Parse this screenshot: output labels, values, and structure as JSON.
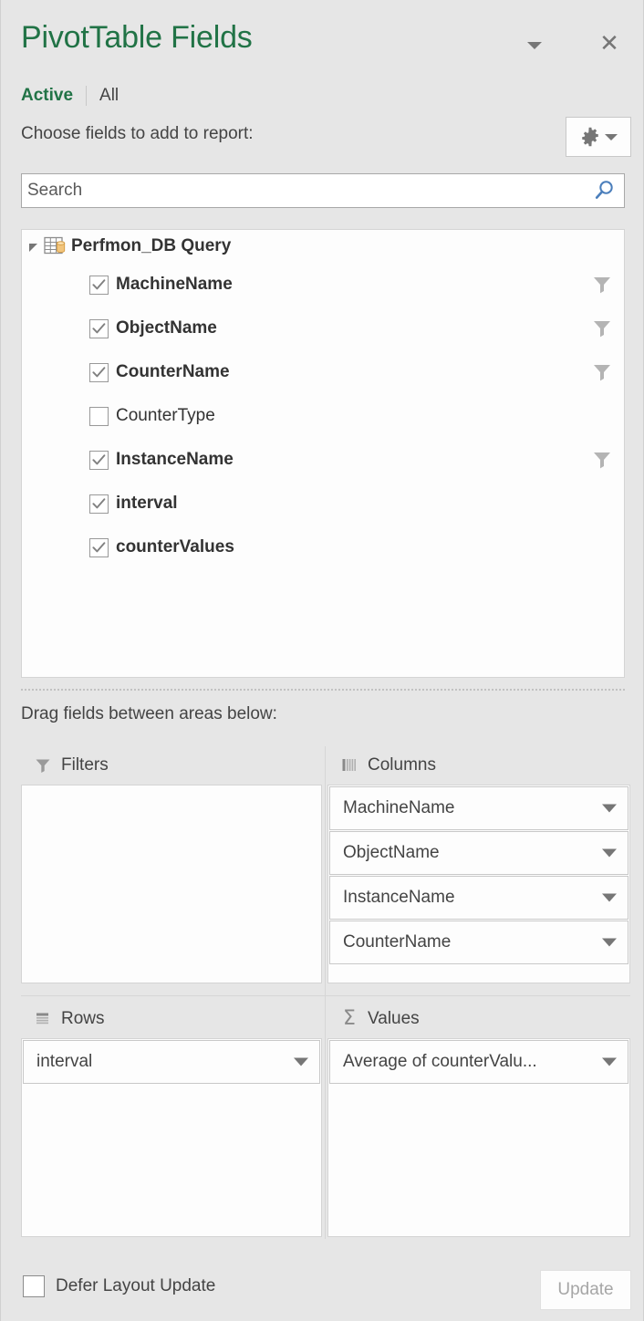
{
  "panel": {
    "title": "PivotTable Fields",
    "title_color": "#217346",
    "background_color": "#e6e6e6",
    "chevron_icon": "chevron-down-icon",
    "close_icon": "close-icon"
  },
  "tabs": {
    "active_label": "Active",
    "all_label": "All",
    "selected": "Active"
  },
  "choose": {
    "label": "Choose fields to add to report:",
    "tools_icon": "gear-icon",
    "tools_dropdown_icon": "chevron-down-icon"
  },
  "search": {
    "value": "",
    "placeholder": "Search",
    "icon": "search-icon",
    "icon_color": "#4a7ebb"
  },
  "field_list": {
    "table_name": "Perfmon_DB Query",
    "table_icon": "table-database-icon",
    "collapse_icon": "collapse-triangle-icon",
    "expanded": true,
    "fields": [
      {
        "label": "MachineName",
        "checked": true,
        "has_filter": true,
        "filter_icon": "filter-funnel-icon"
      },
      {
        "label": "ObjectName",
        "checked": true,
        "has_filter": true,
        "filter_icon": "filter-funnel-icon"
      },
      {
        "label": "CounterName",
        "checked": true,
        "has_filter": true,
        "filter_icon": "filter-funnel-icon"
      },
      {
        "label": "CounterType",
        "checked": false,
        "has_filter": false,
        "filter_icon": ""
      },
      {
        "label": "InstanceName",
        "checked": true,
        "has_filter": true,
        "filter_icon": "filter-funnel-icon"
      },
      {
        "label": "interval",
        "checked": true,
        "has_filter": false,
        "filter_icon": ""
      },
      {
        "label": "counterValues",
        "checked": true,
        "has_filter": false,
        "filter_icon": ""
      }
    ]
  },
  "drag_hint": "Drag fields between areas below:",
  "areas": {
    "filters": {
      "title": "Filters",
      "icon": "filter-funnel-icon",
      "items": []
    },
    "columns": {
      "title": "Columns",
      "icon": "columns-bars-icon",
      "items": [
        {
          "label": "MachineName",
          "dropdown_icon": "chevron-down-icon"
        },
        {
          "label": "ObjectName",
          "dropdown_icon": "chevron-down-icon"
        },
        {
          "label": "InstanceName",
          "dropdown_icon": "chevron-down-icon"
        },
        {
          "label": "CounterName",
          "dropdown_icon": "chevron-down-icon"
        }
      ]
    },
    "rows": {
      "title": "Rows",
      "icon": "rows-lines-icon",
      "items": [
        {
          "label": "interval",
          "dropdown_icon": "chevron-down-icon"
        }
      ]
    },
    "values": {
      "title": "Values",
      "icon": "sigma-icon",
      "sigma_glyph": "Σ",
      "items": [
        {
          "label": "Average of counterValu...",
          "dropdown_icon": "chevron-down-icon"
        }
      ]
    }
  },
  "footer": {
    "defer_label": "Defer Layout Update",
    "defer_checked": false,
    "update_label": "Update",
    "update_disabled": true
  }
}
